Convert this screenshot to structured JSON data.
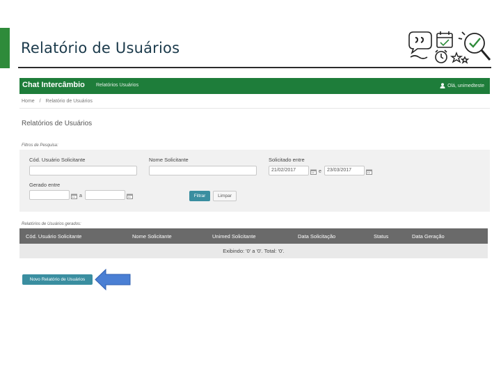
{
  "slide": {
    "title": "Relatório de Usuários"
  },
  "app": {
    "name": "Chat Intercâmbio",
    "nav": "Relatórios Usuários",
    "user": "Olá, unimedteste"
  },
  "breadcrumb": [
    "Home",
    "/",
    "Relatório de Usuários"
  ],
  "page": {
    "heading": "Relatórios de Usuários",
    "filters_label": "Filtros de Pesquisa:"
  },
  "filters": {
    "cod_label": "Cód. Usuário Solicitante",
    "cod_value": "",
    "nome_label": "Nome Solicitante",
    "nome_value": "",
    "solicitado_label": "Solicitado entre",
    "solicitado_from": "21/02/2017",
    "solicitado_to": "23/03/2017",
    "separator": "e",
    "gerado_label": "Gerado entre",
    "gerado_from": "",
    "gerado_to": "",
    "gerado_separator": "a",
    "filter_button": "Filtrar",
    "clear_button": "Limpar"
  },
  "results": {
    "label": "Relatórios de Usuários gerados:",
    "columns": [
      "Cód. Usuário Solicitante",
      "Nome Solicitante",
      "Unimed Solicitante",
      "Data Solicitação",
      "Status",
      "Data Geração"
    ],
    "empty_message": "Exibindo: '0' a '0'. Total: '0'."
  },
  "actions": {
    "new_report": "Novo Relatório de Usuários"
  },
  "colors": {
    "header_green": "#1e7d3a",
    "accent_green": "#2e8b3a",
    "button_teal": "#3a8ea0",
    "arrow_blue": "#4a7fd4"
  },
  "icons": [
    "quote-bubbles-icon",
    "calendar-check-icon",
    "alarm-clock-icon",
    "stars-icon",
    "magnifier-check-icon",
    "user-icon",
    "calendar-icon",
    "left-arrow-icon"
  ]
}
